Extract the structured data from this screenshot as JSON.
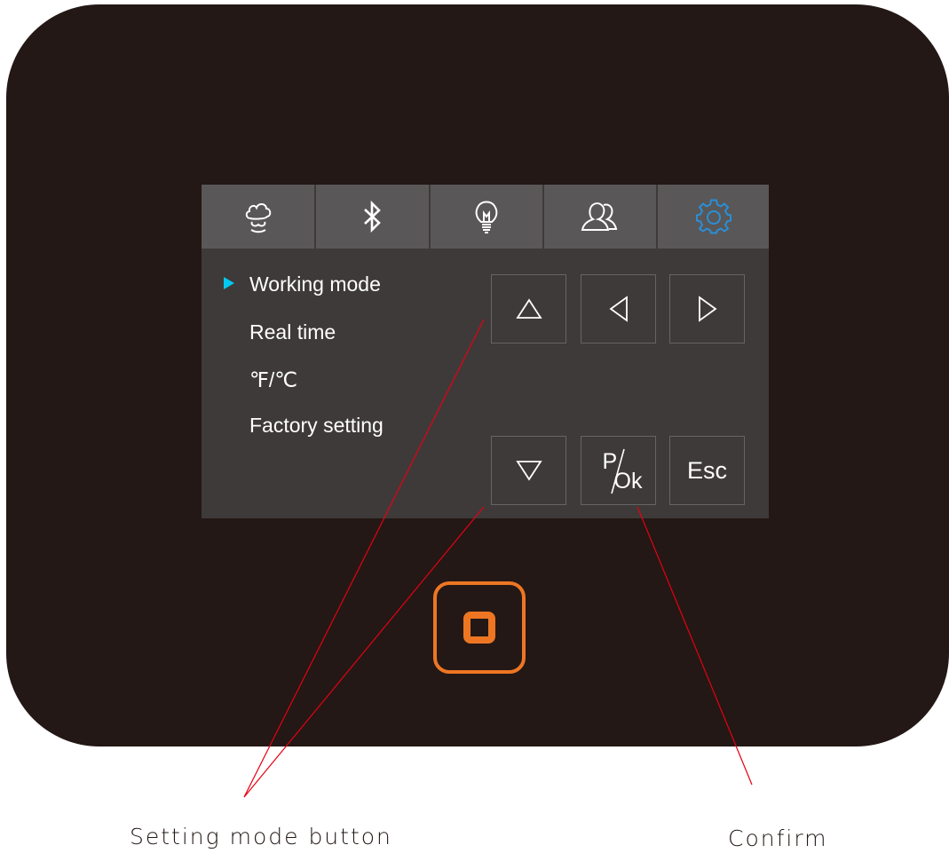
{
  "tabs": [
    {
      "icon": "cloud-icon",
      "active": false
    },
    {
      "icon": "bluetooth-icon",
      "active": false
    },
    {
      "icon": "light-bulb-icon",
      "active": false
    },
    {
      "icon": "users-icon",
      "active": false
    },
    {
      "icon": "gear-icon",
      "active": true
    }
  ],
  "menu": {
    "items": [
      "Working mode",
      "Real time",
      "℉/℃",
      "Factory setting"
    ],
    "selected_index": 0
  },
  "keys": {
    "up": {
      "icon": "up-triangle-icon"
    },
    "left": {
      "icon": "left-triangle-icon"
    },
    "right": {
      "icon": "right-triangle-icon"
    },
    "down": {
      "icon": "down-triangle-icon"
    },
    "ok": {
      "top": "P",
      "bottom": "Ok"
    },
    "esc": {
      "label": "Esc"
    }
  },
  "power": {
    "icon": "power-button-icon"
  },
  "callouts": {
    "setting": "Setting mode button",
    "confirm": "Confirm"
  },
  "colors": {
    "device": "#231815",
    "screen": "#3e3a39",
    "tab": "#595757",
    "active_icon": "#2a8fd6",
    "pointer": "#00c8f0",
    "power": "#ee7623",
    "leader": "#e60012"
  }
}
